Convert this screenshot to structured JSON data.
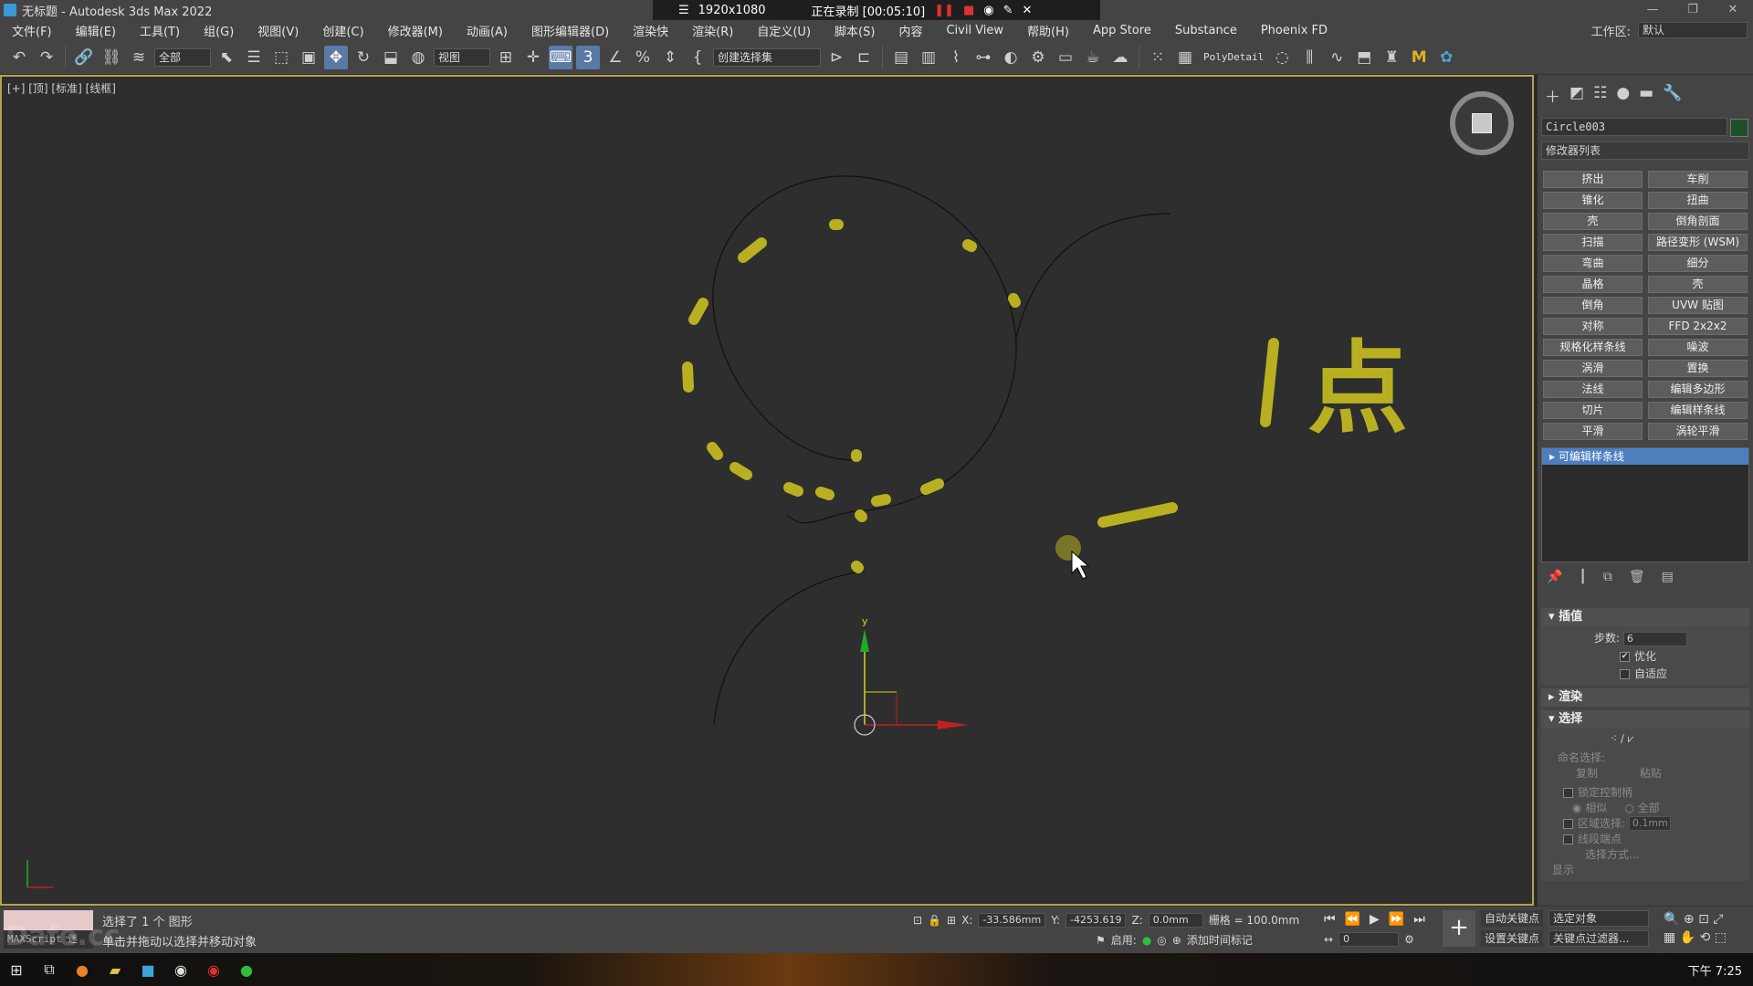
{
  "titlebar": {
    "title": "无标题 - Autodesk 3ds Max 2022"
  },
  "recorder": {
    "resolution": "1920x1080",
    "status": "正在录制 [00:05:10]"
  },
  "menu": [
    "文件(F)",
    "编辑(E)",
    "工具(T)",
    "组(G)",
    "视图(V)",
    "创建(C)",
    "修改器(M)",
    "动画(A)",
    "图形编辑器(D)",
    "渲染快",
    "渲染(R)",
    "自定义(U)",
    "脚本(S)",
    "内容",
    "Civil View",
    "帮助(H)",
    "App Store",
    "Substance",
    "Phoenix FD"
  ],
  "workspace": {
    "label": "工作区:",
    "value": "默认"
  },
  "toolbar": {
    "filter_value": "全部",
    "ref_coord_value": "视图",
    "selection_set_placeholder": "创建选择集",
    "polydetail_label": "PolyDetail"
  },
  "viewport": {
    "label": "[+] [顶] [标准] [线框]",
    "annotation_text": "点",
    "annotation_color": "#b8b020"
  },
  "command_panel": {
    "object_name": "Circle003",
    "object_color": "#1e4f2b",
    "modifier_list": "修改器列表",
    "modifier_buttons": [
      "挤出",
      "车削",
      "锥化",
      "扭曲",
      "壳",
      "倒角剖面",
      "扫描",
      "路径变形 (WSM)",
      "弯曲",
      "细分",
      "晶格",
      "壳",
      "倒角",
      "UVW 贴图",
      "对称",
      "FFD 2x2x2",
      "规格化样条线",
      "噪波",
      "涡滑",
      "置换",
      "法线",
      "编辑多边形",
      "切片",
      "编辑样条线",
      "平滑",
      "涡轮平滑"
    ],
    "stack_item": "可编辑样条线",
    "interpolation": {
      "title": "插值",
      "steps_label": "步数:",
      "steps_value": "6",
      "optimize_label": "优化",
      "adaptive_label": "自适应"
    },
    "render_title": "渲染",
    "selection": {
      "title": "选择",
      "named_sel_label": "命名选择:",
      "copy_label": "复制",
      "paste_label": "粘贴",
      "lock_handles_label": "锁定控制柄",
      "similar_label": "相似",
      "all_label": "全部",
      "area_sel_label": "区域选择:",
      "area_value": "0.1mm",
      "segment_end_label": "线段端点",
      "select_by_label": "选择方式...",
      "display_label": "显示"
    }
  },
  "status": {
    "maxscript_label": "MAXScript 迷",
    "line1": "选择了 1 个 图形",
    "line2": "单击并拖动以选择并移动对象",
    "x_label": "X:",
    "x_value": "-33.586mm",
    "y_label": "Y:",
    "y_value": "-4253.619",
    "z_label": "Z:",
    "z_value": "0.0mm",
    "grid_label": "栅格 = 100.0mm",
    "enable_label": "启用:",
    "add_time_tag": "添加时间标记",
    "frame_value": "0",
    "auto_key": "自动关键点",
    "selected_objects": "选定对象",
    "set_key": "设置关键点",
    "key_filters": "关键点过滤器..."
  },
  "taskbar": {
    "clock": "下午 7:25"
  },
  "watermark": "Dafe.cc"
}
